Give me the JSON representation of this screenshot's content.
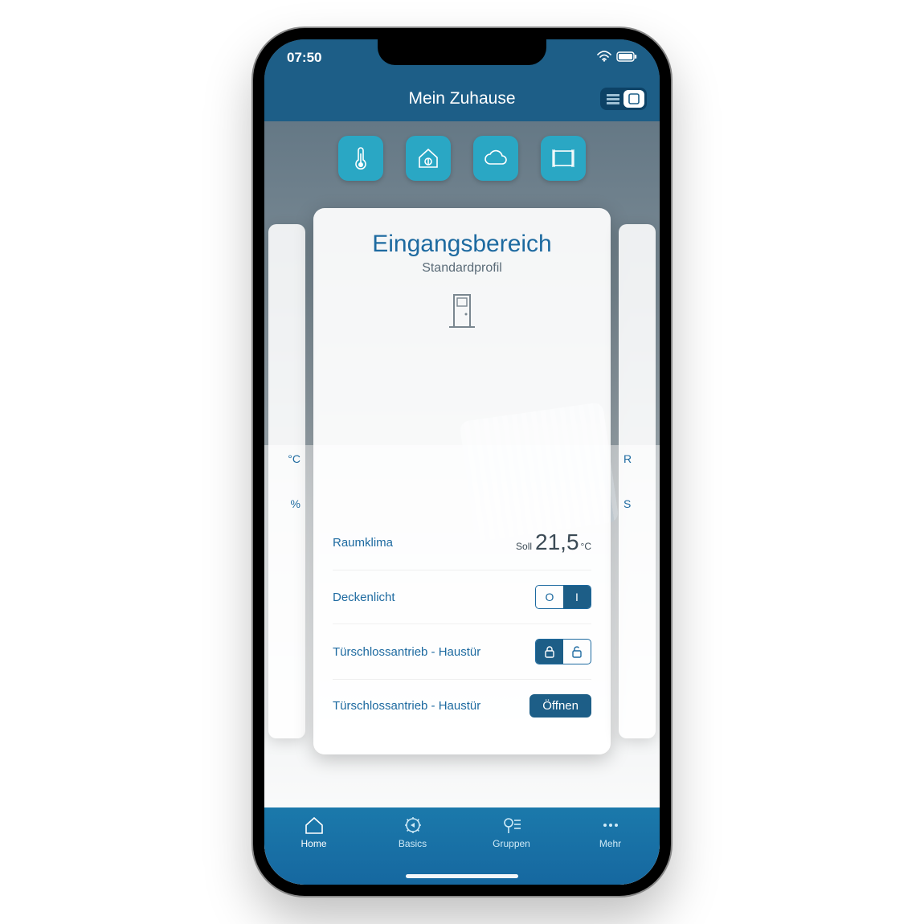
{
  "status": {
    "time": "07:50"
  },
  "header": {
    "title": "Mein Zuhause"
  },
  "card": {
    "title": "Eingangsbereich",
    "subtitle": "Standardprofil",
    "climate": {
      "label": "Raumklima",
      "prefix": "Soll",
      "value": "21,5",
      "unit": "°C"
    },
    "light": {
      "label": "Deckenlicht",
      "off": "O",
      "on": "I"
    },
    "lock": {
      "label": "Türschlossantrieb - Haustür"
    },
    "open": {
      "label": "Türschlossantrieb - Haustür",
      "button": "Öffnen"
    }
  },
  "side": {
    "left_c": "°C",
    "left_pct": "%",
    "right_r": "R",
    "right_s": "S"
  },
  "tabs": {
    "home": "Home",
    "basics": "Basics",
    "groups": "Gruppen",
    "more": "Mehr"
  }
}
